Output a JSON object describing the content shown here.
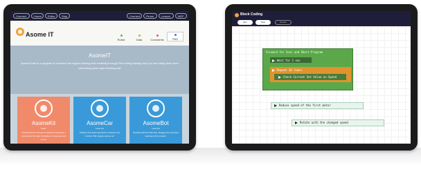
{
  "left_tablet": {
    "topbar": {
      "left_buttons": [
        "Connect",
        "Home",
        "Editor",
        "Stop"
      ],
      "right_buttons": [
        "Connect",
        "Firmw",
        "Lesson",
        "MEF"
      ]
    },
    "header": {
      "logo_text": "Asome IT",
      "nav": [
        {
          "label": "Robot",
          "color": "#6ab04c"
        },
        {
          "label": "Data",
          "color": "#e6a23c"
        },
        {
          "label": "Comments",
          "color": "#e55"
        },
        {
          "label": "PAS",
          "color": "#3a7bd5"
        }
      ]
    },
    "hero": {
      "title": "AsomeIT",
      "description": "AsomeCode is a program to enhance the logical thinking and creativity through SW coding training and you can easily learn from interesting game-type teaching aid."
    },
    "cards": [
      {
        "title": "AsomeKit",
        "subtitle": "Basic",
        "description": "Understand the concept of physical computing + understand the basic principles of computer and circuit.",
        "color": "#f08a6a"
      },
      {
        "title": "AsomeCar",
        "subtitle": "Level Up",
        "description": "Program the wide experience of Asome Car Control. SW, logical, and so on!",
        "color": "#3a9ad9"
      },
      {
        "title": "AsomeBot",
        "subtitle": "Level Up",
        "description": "Develop with the help also. Engage the next level learning of the product.",
        "color": "#3a9ad9"
      }
    ]
  },
  "right_tablet": {
    "title": "Block Coding",
    "tabs": [
      "Run",
      "Stop",
      "Source"
    ],
    "blocks": {
      "outer_label": "Forward for 3sec and Short Program",
      "wait_label": "Wait for 1 sec",
      "repeat_label": "Repeat 10 times",
      "inner_label": "Check Current Set Value on Speed",
      "reduce_label": "Reduce speed of the first motor",
      "rotate_label": "Rotate with the changed speed"
    }
  }
}
